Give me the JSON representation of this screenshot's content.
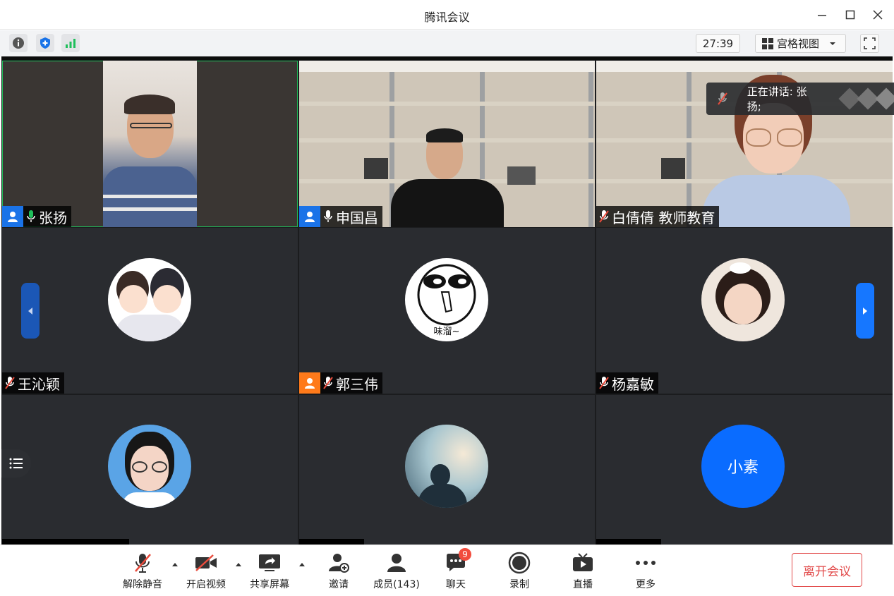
{
  "window": {
    "title": "腾讯会议",
    "minimize_icon": "minimize-icon",
    "maximize_icon": "maximize-icon",
    "close_icon": "close-icon"
  },
  "info_bar": {
    "icons": [
      "info-icon",
      "shield-icon",
      "signal-icon"
    ],
    "timer": "27:39",
    "view_mode": "宫格视图",
    "fullscreen_icon": "fullscreen-icon"
  },
  "speaking_banner": {
    "text": "正在讲话: 张扬;"
  },
  "participants": [
    {
      "name": "张扬",
      "host": true,
      "muted": false,
      "video": true
    },
    {
      "name": "申国昌",
      "host": true,
      "muted": false,
      "video": true
    },
    {
      "name": "白倩倩 教师教育",
      "host": false,
      "muted": true,
      "video": true
    },
    {
      "name": "王沁颖",
      "host": false,
      "muted": true,
      "video": false
    },
    {
      "name": "郭三伟",
      "host": true,
      "muted": true,
      "video": false,
      "host_color": "#ff7a1a"
    },
    {
      "name": "杨嘉敏",
      "host": false,
      "muted": true,
      "video": false
    },
    {
      "name": "",
      "host": false,
      "muted": true,
      "video": false
    },
    {
      "name": "",
      "host": false,
      "muted": true,
      "video": false
    },
    {
      "name": "",
      "host": false,
      "muted": true,
      "video": false,
      "avatar_text": "小素"
    }
  ],
  "avatar_caption": "味溜~",
  "bottom_bar": {
    "buttons": [
      {
        "label": "解除静音",
        "icon": "mic-muted-icon"
      },
      {
        "label": "开启视频",
        "icon": "video-off-icon"
      },
      {
        "label": "共享屏幕",
        "icon": "share-screen-icon"
      },
      {
        "label": "邀请",
        "icon": "invite-icon"
      },
      {
        "label": "成员(143)",
        "icon": "members-icon"
      },
      {
        "label": "聊天",
        "icon": "chat-icon",
        "badge": "9"
      },
      {
        "label": "录制",
        "icon": "record-icon"
      },
      {
        "label": "直播",
        "icon": "live-icon"
      },
      {
        "label": "更多",
        "icon": "more-icon"
      }
    ],
    "leave_label": "离开会议"
  },
  "colors": {
    "accent_blue": "#0a6cff",
    "host_blue": "#1a73e8",
    "leave_red": "#e24a4a",
    "active_speaker": "#1fbf5b"
  }
}
